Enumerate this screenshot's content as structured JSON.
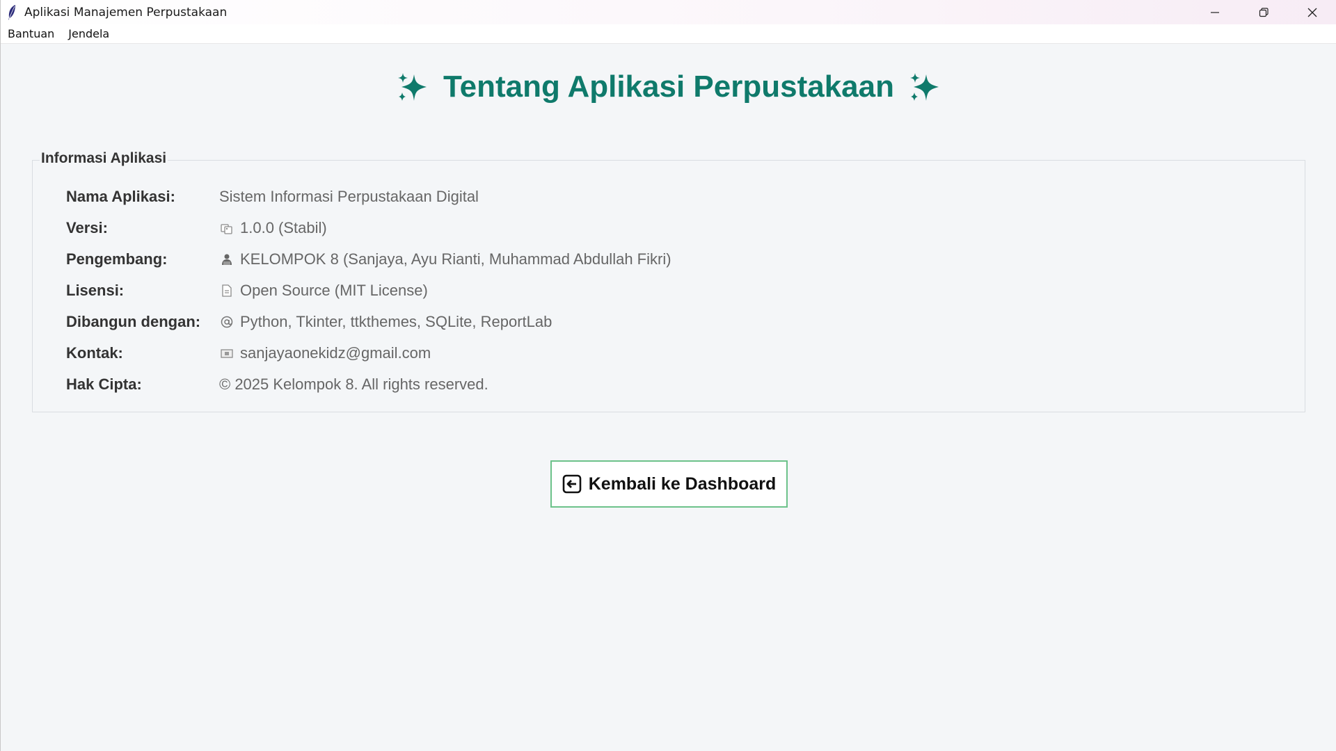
{
  "window": {
    "title": "Aplikasi Manajemen Perpustakaan"
  },
  "menubar": {
    "items": [
      {
        "label": "Bantuan"
      },
      {
        "label": "Jendela"
      }
    ]
  },
  "heading": {
    "title": "Tentang Aplikasi Perpustakaan",
    "color": "#0f7a6b"
  },
  "info": {
    "legend": "Informasi Aplikasi",
    "rows": [
      {
        "label": "Nama Aplikasi:",
        "value": "Sistem Informasi Perpustakaan Digital",
        "icon": ""
      },
      {
        "label": "Versi:",
        "value": "1.0.0 (Stabil)",
        "icon": "tags-icon"
      },
      {
        "label": "Pengembang:",
        "value": "KELOMPOK 8 (Sanjaya, Ayu Rianti, Muhammad Abdullah Fikri)",
        "icon": "developer-icon"
      },
      {
        "label": "Lisensi:",
        "value": "Open Source (MIT License)",
        "icon": "document-icon"
      },
      {
        "label": "Dibangun dengan:",
        "value": "Python, Tkinter, ttkthemes, SQLite, ReportLab",
        "icon": "at-sign-icon"
      },
      {
        "label": "Kontak:",
        "value": "sanjayaonekidz@gmail.com",
        "icon": "envelope-icon"
      },
      {
        "label": "Hak Cipta:",
        "value": "© 2025 Kelompok 8. All rights reserved.",
        "icon": ""
      }
    ]
  },
  "back_button": {
    "label": "Kembali ke Dashboard",
    "border_color": "#6cc28a"
  }
}
